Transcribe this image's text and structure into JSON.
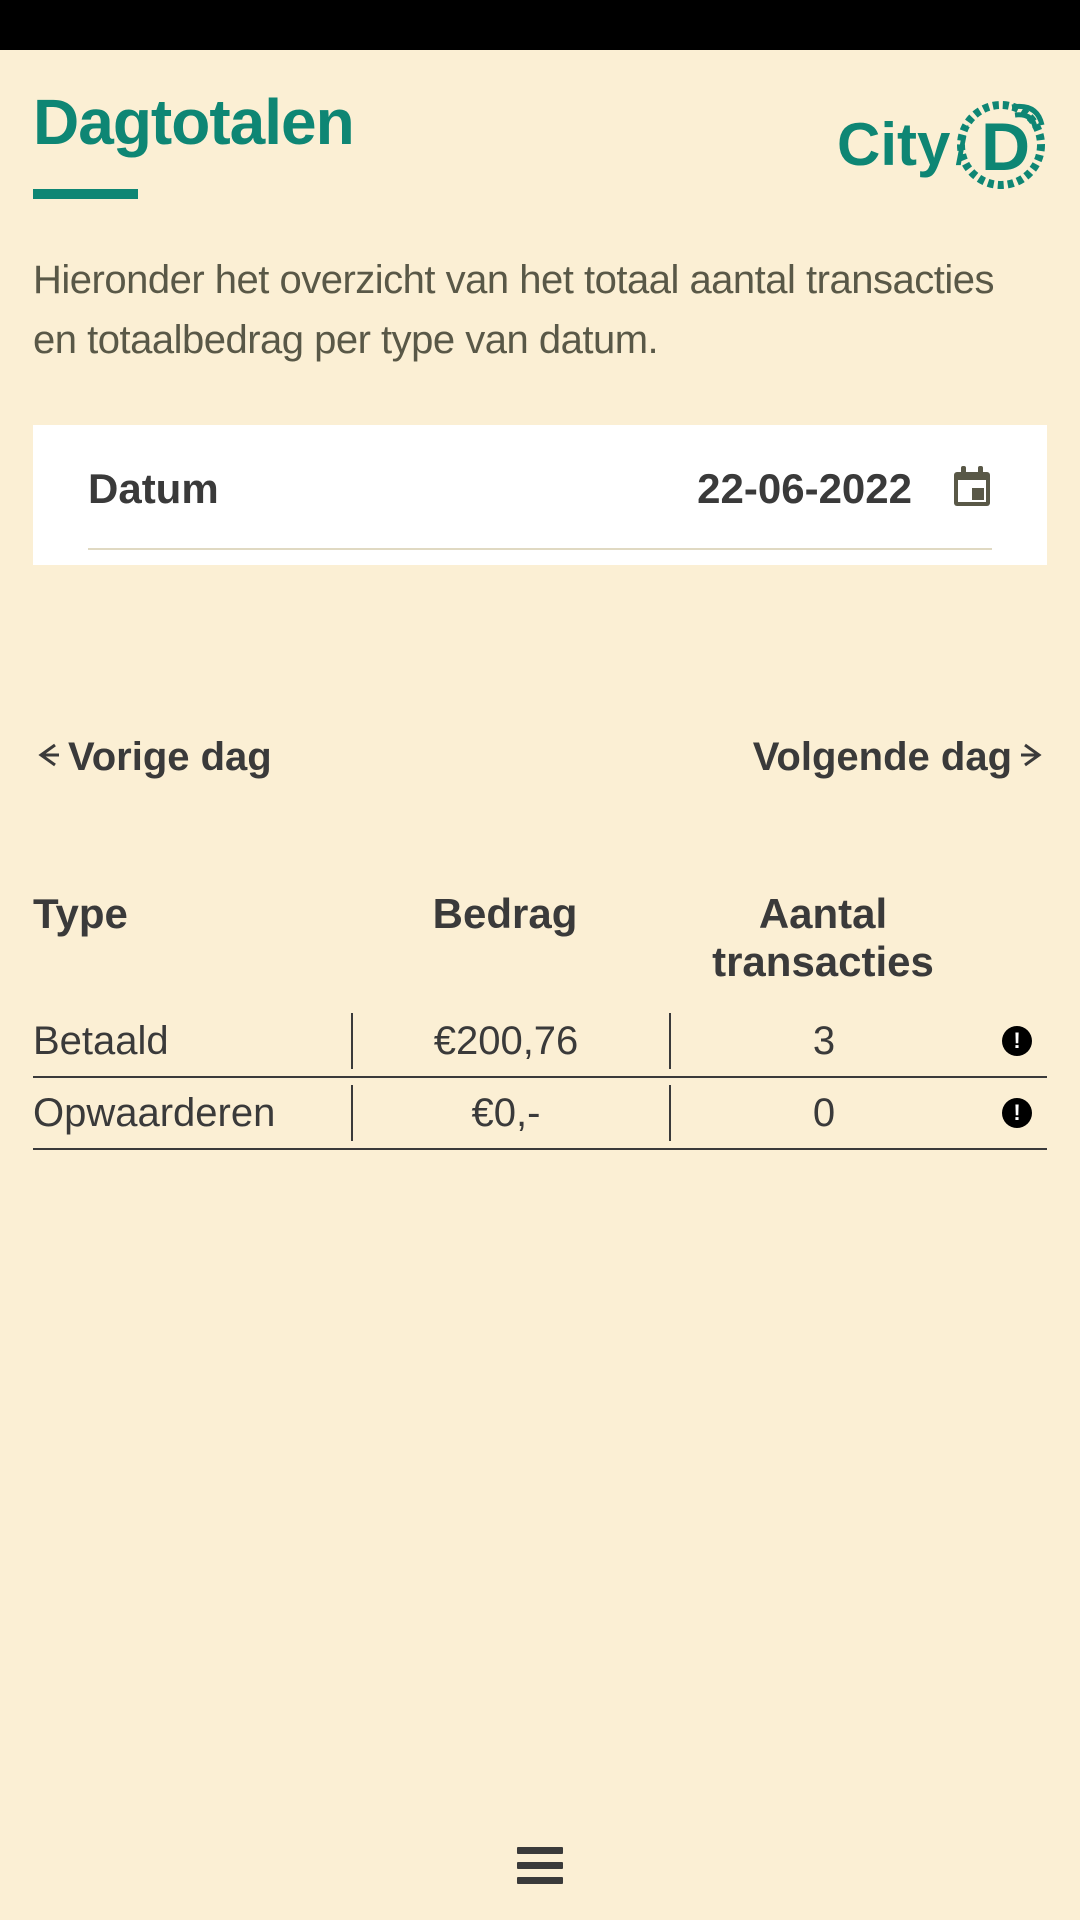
{
  "header": {
    "title": "Dagtotalen",
    "logo_text_left": "City",
    "logo_text_right": "D"
  },
  "description": "Hieronder het overzicht van het totaal aantal transacties en totaalbedrag per type van datum.",
  "date_picker": {
    "label": "Datum",
    "value": "22-06-2022"
  },
  "navigation": {
    "prev_label": "Vorige dag",
    "next_label": "Volgende dag"
  },
  "table": {
    "headers": {
      "type": "Type",
      "amount": "Bedrag",
      "transactions": "Aantal transacties"
    },
    "rows": [
      {
        "type": "Betaald",
        "amount": "€200,76",
        "count": "3"
      },
      {
        "type": "Opwaarderen",
        "amount": "€0,-",
        "count": "0"
      }
    ]
  },
  "colors": {
    "accent": "#0e8674",
    "background": "#fbefd4"
  }
}
